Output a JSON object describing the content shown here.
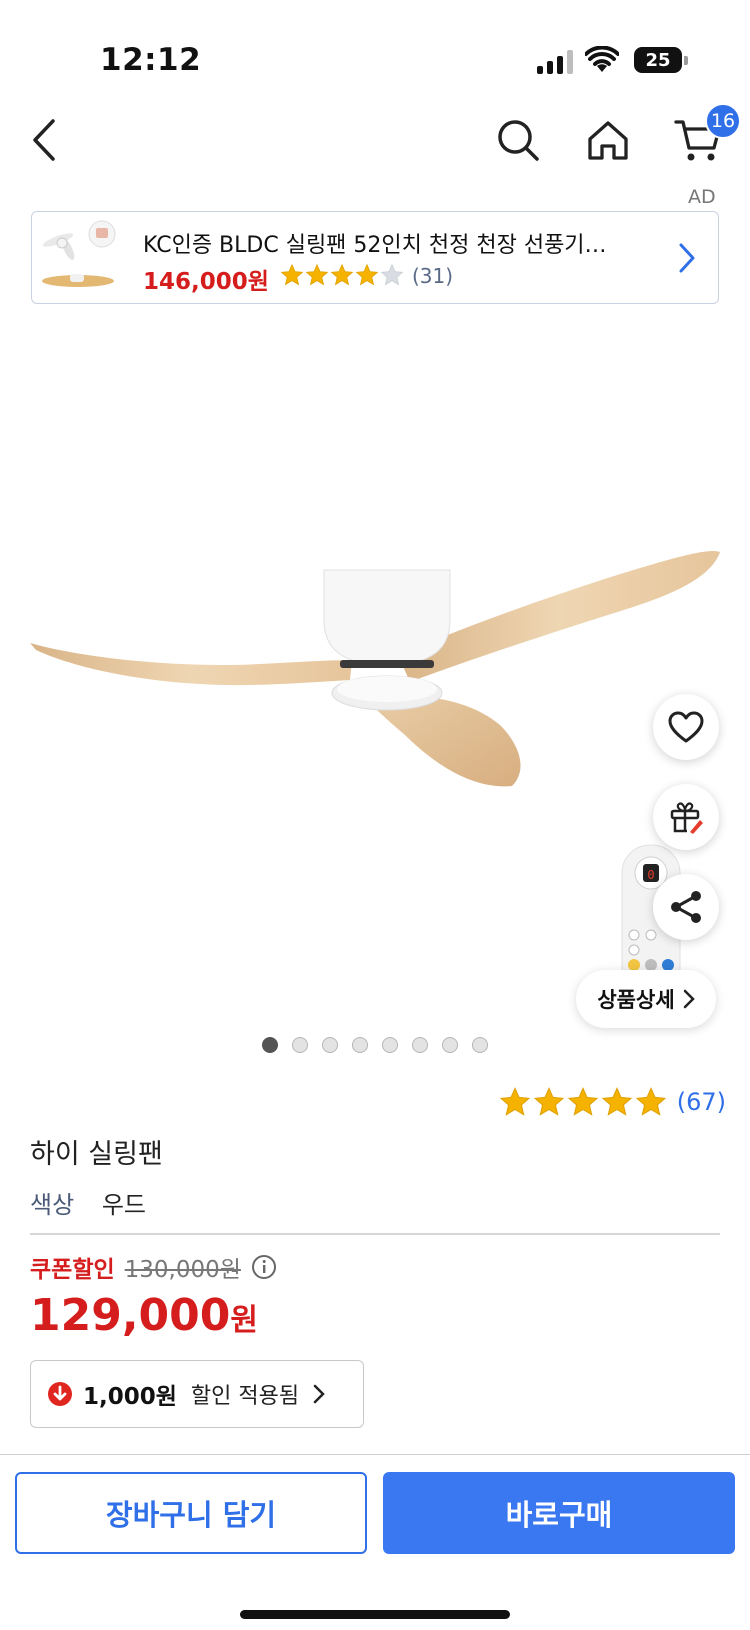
{
  "status": {
    "time": "12:12",
    "battery": "25"
  },
  "nav": {
    "cart_count": "16"
  },
  "ad": {
    "label": "AD",
    "title": "KC인증 BLDC 실링팬 52인치 천정 천장 선풍기…",
    "price": "146,000원",
    "rating": 4,
    "reviews": "(31)"
  },
  "product": {
    "image_count": 8,
    "active_image": 1,
    "detail_label": "상품상세",
    "rating": 5,
    "review_count": "(67)",
    "name": "하이 실링팬",
    "option_label": "색상",
    "option_value": "우드",
    "coupon_label": "쿠폰할인",
    "original_price": "130,000원",
    "price": "129,000",
    "price_unit": "원",
    "discount_amount": "1,000원",
    "discount_text": "할인 적용됨"
  },
  "actions": {
    "cart_label": "장바구니 담기",
    "buy_label": "바로구매"
  },
  "colors": {
    "accent": "#2f6fe8",
    "price_red": "#d61d1d",
    "star": "#f5b300",
    "wood": "#e8c9a0"
  }
}
